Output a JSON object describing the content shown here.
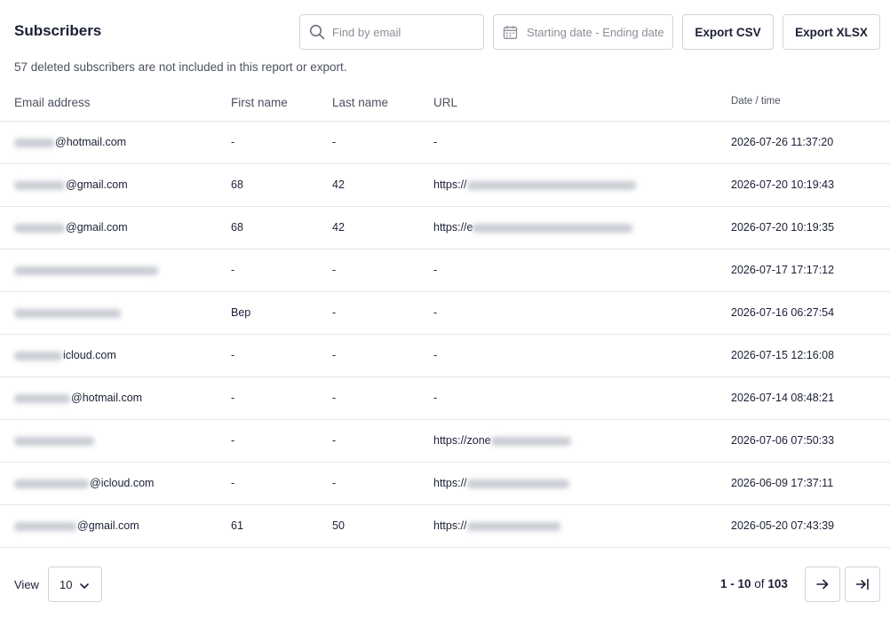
{
  "header": {
    "title": "Subscribers",
    "search_placeholder": "Find by email",
    "date_placeholder": "Starting date - Ending date",
    "export_csv_label": "Export CSV",
    "export_xlsx_label": "Export XLSX"
  },
  "note": "57 deleted subscribers are not included in this report or export.",
  "columns": {
    "email": "Email address",
    "first_name": "First name",
    "last_name": "Last name",
    "url": "URL",
    "datetime": "Date / time"
  },
  "rows": [
    {
      "email_visible": "@hotmail.com",
      "first": "-",
      "last": "-",
      "url_visible": "-",
      "date": "2026-07-26 11:37:20"
    },
    {
      "email_visible": "@gmail.com",
      "first": "68",
      "last": "42",
      "url_visible": "https://",
      "date": "2026-07-20 10:19:43"
    },
    {
      "email_visible": "@gmail.com",
      "first": "68",
      "last": "42",
      "url_visible": "https://e",
      "date": "2026-07-20 10:19:35"
    },
    {
      "email_visible": "",
      "first": "-",
      "last": "-",
      "url_visible": "-",
      "date": "2026-07-17 17:17:12"
    },
    {
      "email_visible": "",
      "first": "Bep",
      "last": "-",
      "url_visible": "-",
      "date": "2026-07-16 06:27:54"
    },
    {
      "email_visible": "icloud.com",
      "first": "-",
      "last": "-",
      "url_visible": "-",
      "date": "2026-07-15 12:16:08"
    },
    {
      "email_visible": "@hotmail.com",
      "first": "-",
      "last": "-",
      "url_visible": "-",
      "date": "2026-07-14 08:48:21"
    },
    {
      "email_visible": "",
      "first": "-",
      "last": "-",
      "url_visible": "https://zone",
      "date": "2026-07-06 07:50:33"
    },
    {
      "email_visible": "@icloud.com",
      "first": "-",
      "last": "-",
      "url_visible": "https://",
      "date": "2026-06-09 17:37:11"
    },
    {
      "email_visible": "@gmail.com",
      "first": "61",
      "last": "50",
      "url_visible": "https://",
      "date": "2026-05-20 07:43:39"
    }
  ],
  "footer": {
    "view_label": "View",
    "page_size": "10",
    "range": "1 - 10",
    "of_label": "of",
    "total": "103"
  },
  "icons": {
    "search": "search-icon",
    "calendar": "calendar-icon",
    "chevron": "chevron-down-icon",
    "next": "arrow-right-icon",
    "last": "arrow-right-to-line-icon"
  }
}
